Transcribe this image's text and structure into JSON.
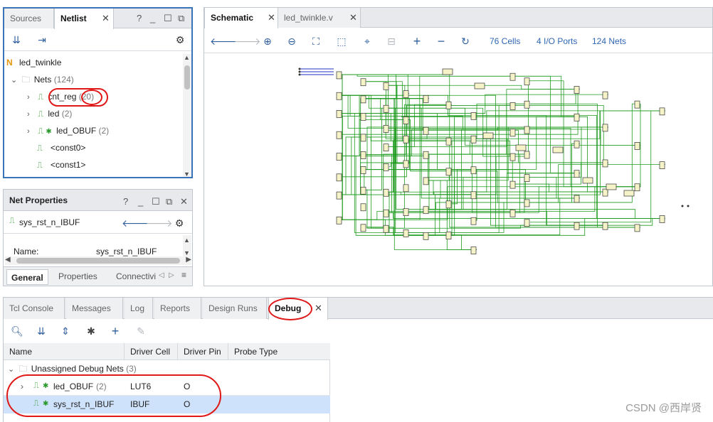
{
  "colors": {
    "accent": "#3b73b9",
    "link_blue": "#2f66b3",
    "schematic_wire": "#1f9b1f",
    "cell_fill": "#f6f3c9",
    "annotation_red": "#e01818",
    "selected_row": "#cfe2fb"
  },
  "netlist_panel": {
    "tabs": [
      {
        "label": "Sources"
      },
      {
        "label": "Netlist"
      }
    ],
    "help": "?",
    "root": "led_twinkle",
    "nets_label": "Nets",
    "nets_count": "(124)",
    "items": [
      {
        "label": "cnt_reg",
        "count": "(20)",
        "expandable": true
      },
      {
        "label": "led",
        "count": "(2)",
        "expandable": true
      },
      {
        "label": "led_OBUF",
        "count": "(2)",
        "expandable": true
      },
      {
        "label": "<const0>",
        "count": "",
        "expandable": false
      },
      {
        "label": "<const1>",
        "count": "",
        "expandable": false
      }
    ]
  },
  "net_properties": {
    "title": "Net Properties",
    "help": "?",
    "net_name": "sys_rst_n_IBUF",
    "name_label": "Name:",
    "name_value": "sys_rst_n_IBUF",
    "tabs": [
      {
        "label": "General"
      },
      {
        "label": "Properties"
      },
      {
        "label": "Connectivi"
      }
    ]
  },
  "schematic": {
    "tabs": [
      {
        "label": "Schematic"
      },
      {
        "label": "led_twinkle.v"
      }
    ],
    "cells": "76 Cells",
    "io_ports": "4 I/O Ports",
    "nets": "124 Nets"
  },
  "bottom": {
    "tabs": [
      {
        "label": "Tcl Console"
      },
      {
        "label": "Messages"
      },
      {
        "label": "Log"
      },
      {
        "label": "Reports"
      },
      {
        "label": "Design Runs"
      },
      {
        "label": "Debug"
      }
    ],
    "columns": [
      "Name",
      "Driver Cell",
      "Driver Pin",
      "Probe Type"
    ],
    "group": {
      "label": "Unassigned Debug Nets",
      "count": "(3)"
    },
    "rows": [
      {
        "name": "led_OBUF",
        "count": "(2)",
        "driver_cell": "LUT6",
        "driver_pin": "O",
        "probe_type": ""
      },
      {
        "name": "sys_rst_n_IBUF",
        "count": "",
        "driver_cell": "IBUF",
        "driver_pin": "O",
        "probe_type": ""
      }
    ]
  },
  "watermark": "CSDN @西岸贤"
}
